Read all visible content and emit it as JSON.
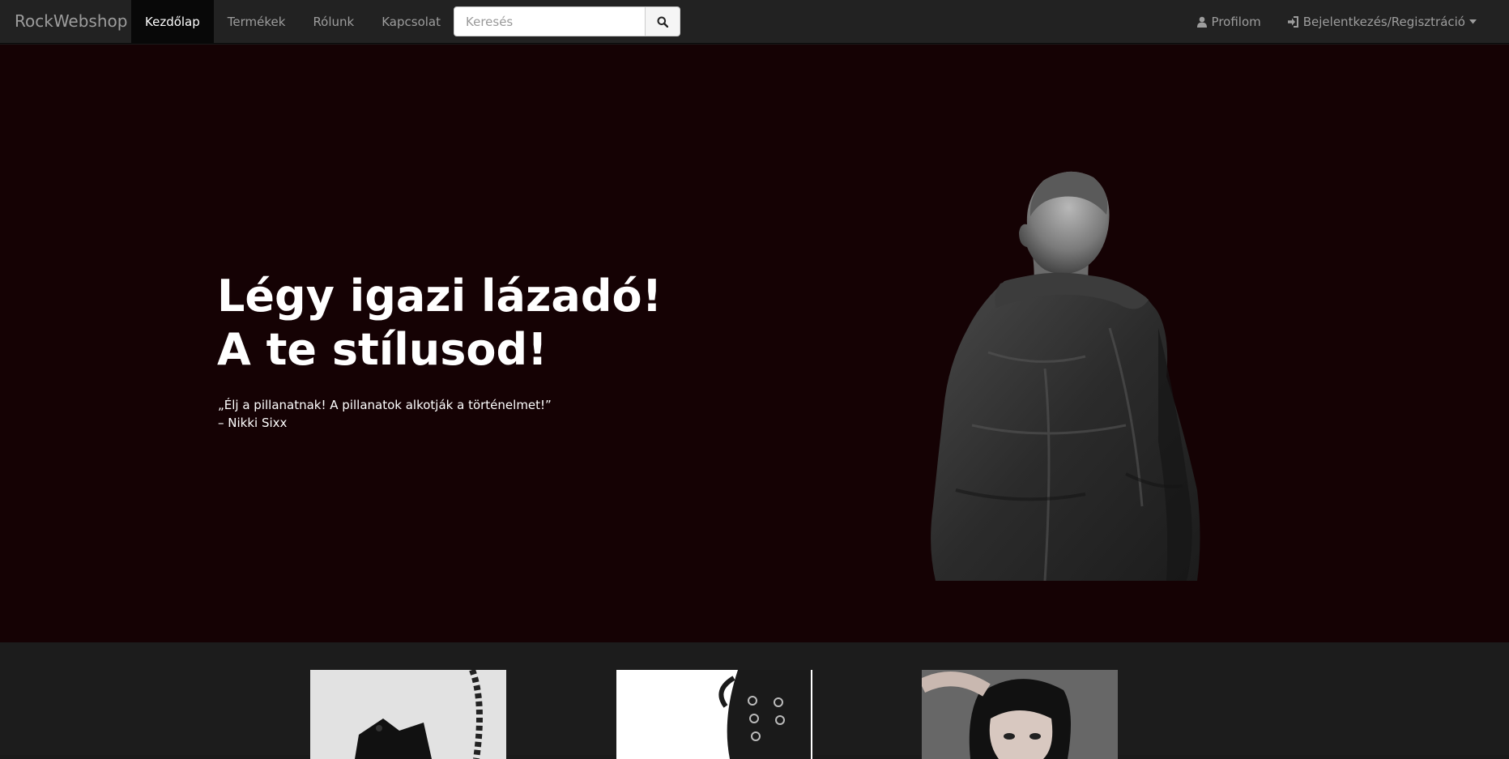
{
  "navbar": {
    "brand": "RockWebshop",
    "links": [
      {
        "label": "Kezdőlap",
        "active": true
      },
      {
        "label": "Termékek"
      },
      {
        "label": "Rólunk"
      },
      {
        "label": "Kapcsolat"
      }
    ],
    "search": {
      "placeholder": "Keresés",
      "icon": "search-icon"
    },
    "profile": {
      "label": "Profilom",
      "icon": "user-icon"
    },
    "login": {
      "label": "Bejelentkezés/Regisztráció",
      "icon": "sign-in-icon",
      "caret": "caret-down-icon"
    }
  },
  "hero": {
    "title_line1": "Légy igazi lázadó!",
    "title_line2": "A te stílusod!",
    "quote": "„Élj a pillanatnak! A pillanatok alkotják a történelmet!”",
    "author": "– Nikki Sixx"
  },
  "products": [
    {
      "image": "chain-product-image"
    },
    {
      "image": "boot-product-image"
    },
    {
      "image": "model-product-image"
    }
  ],
  "colors": {
    "navbar": "#222222",
    "hero_bg": "#150204",
    "products_bg": "#1c1c1c"
  }
}
